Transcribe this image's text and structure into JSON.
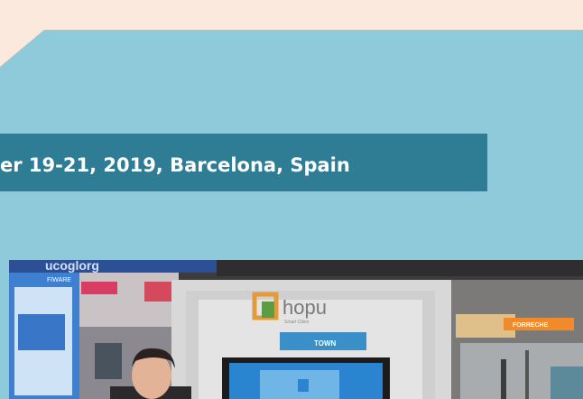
{
  "banner": {
    "event_text": "er 19-21, 2019, Barcelona, Spain"
  },
  "photo": {
    "booth_logo_text": "hopu",
    "booth_logo_sub": "Smart Cities",
    "screen_sign_text": "TOWN",
    "left_panel_brand": "FIWARE",
    "right_sign_text": "FORRECHE",
    "top_sign_text": "ucoglorg"
  }
}
